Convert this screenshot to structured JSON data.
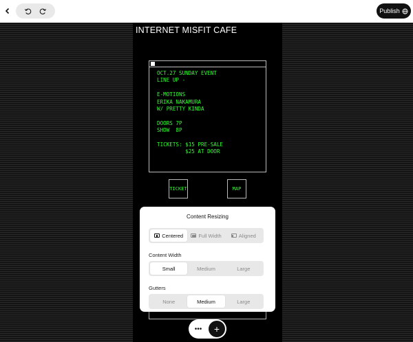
{
  "toolbar": {
    "back_icon": "chevron-left-icon",
    "undo_icon": "undo-icon",
    "redo_icon": "redo-icon",
    "publish_label": "Publish",
    "publish_icon": "globe-icon"
  },
  "site": {
    "title": "INTERNET MISFIT CAFE",
    "event_text": "OCT.27 SUNDAY EVENT\nLINE UP -\n\nE-MOTIONS\nERIKA NAKAMURA\nW/ PRETTY KINDA\n\nDOORS 7P\nSHOW  8P\n\nTICKETS: $15 PRE-SALE\n         $25 AT DOOR",
    "ticket_label": "TICKET",
    "map_label": "MAP",
    "text_color": "#33ff33"
  },
  "panel": {
    "title": "Content Resizing",
    "resizing_options": [
      "Centered",
      "Full Width",
      "Aligned"
    ],
    "resizing_selected": "Centered",
    "width_label": "Content Width",
    "width_options": [
      "Small",
      "Medium",
      "Large"
    ],
    "width_selected": "Small",
    "gutters_label": "Gutters",
    "gutters_options": [
      "None",
      "Medium",
      "Large"
    ],
    "gutters_selected": "Medium"
  },
  "fab": {
    "more_label": "•••",
    "add_label": "+"
  }
}
